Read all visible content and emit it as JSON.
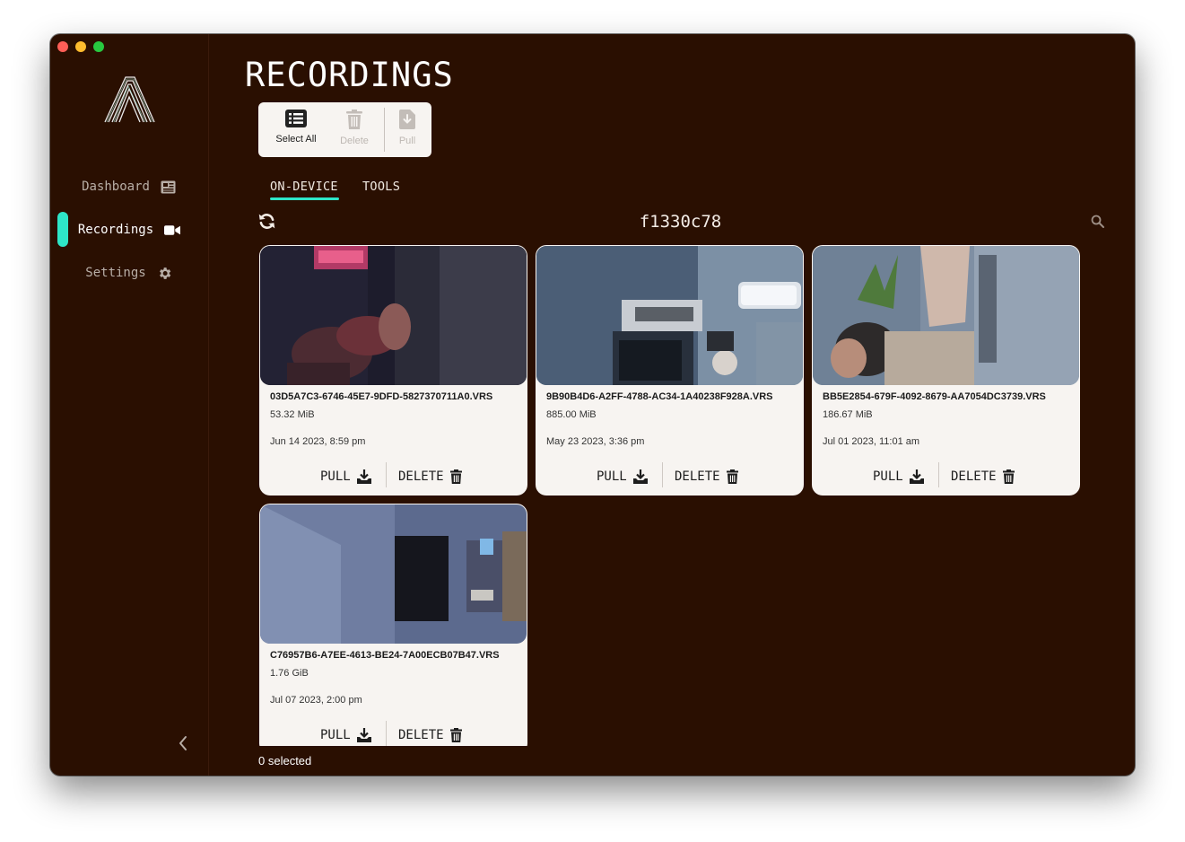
{
  "window": {
    "controls": [
      "close",
      "minimize",
      "zoom"
    ]
  },
  "sidebar": {
    "logo_icon": "aria-logo-icon",
    "items": [
      {
        "label": "Dashboard",
        "icon": "newspaper-icon",
        "active": false
      },
      {
        "label": "Recordings",
        "icon": "video-camera-icon",
        "active": true
      },
      {
        "label": "Settings",
        "icon": "gear-icon",
        "active": false
      }
    ],
    "collapse_icon": "chevron-left-icon"
  },
  "page": {
    "title": "RECORDINGS"
  },
  "toolbar": {
    "select_all": "Select All",
    "delete": "Delete",
    "pull": "Pull"
  },
  "tabs": [
    {
      "label": "ON-DEVICE",
      "active": true
    },
    {
      "label": "TOOLS",
      "active": false
    }
  ],
  "device": {
    "name": "f1330c78",
    "refresh_icon": "refresh-icon",
    "search_icon": "search-icon"
  },
  "recordings": [
    {
      "filename": "03D5A7C3-6746-45E7-9DFD-5827370711A0.VRS",
      "size": "53.32 MiB",
      "date": "Jun 14 2023, 8:59 pm",
      "pull": "PULL",
      "delete": "DELETE"
    },
    {
      "filename": "9B90B4D6-A2FF-4788-AC34-1A40238F928A.VRS",
      "size": "885.00 MiB",
      "date": "May 23 2023, 3:36 pm",
      "pull": "PULL",
      "delete": "DELETE"
    },
    {
      "filename": "BB5E2854-679F-4092-8679-AA7054DC3739.VRS",
      "size": "186.67 MiB",
      "date": "Jul 01 2023, 11:01 am",
      "pull": "PULL",
      "delete": "DELETE"
    },
    {
      "filename": "C76957B6-A7EE-4613-BE24-7A00ECB07B47.VRS",
      "size": "1.76 GiB",
      "date": "Jul 07 2023, 2:00 pm",
      "pull": "PULL",
      "delete": "DELETE"
    }
  ],
  "status": {
    "selected": "0 selected"
  },
  "colors": {
    "background": "#2a0f01",
    "accent": "#2ee6c8",
    "card": "#f7f4f1"
  }
}
